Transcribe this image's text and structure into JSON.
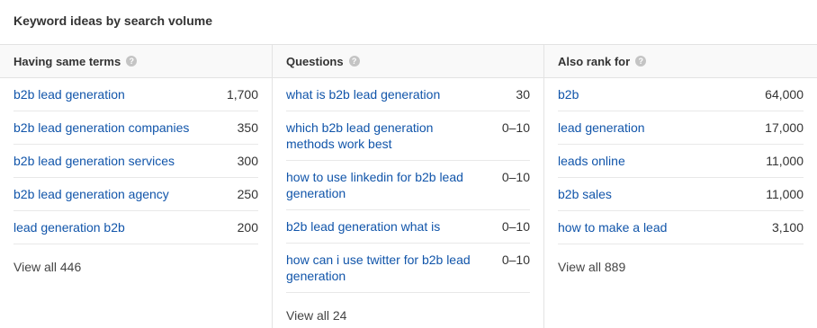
{
  "title": "Keyword ideas by search volume",
  "columns": [
    {
      "header": "Having same terms",
      "help_icon": "question-mark-circle",
      "rows": [
        {
          "keyword": "b2b lead generation",
          "volume": "1,700"
        },
        {
          "keyword": "b2b lead generation companies",
          "volume": "350"
        },
        {
          "keyword": "b2b lead generation services",
          "volume": "300"
        },
        {
          "keyword": "b2b lead generation agency",
          "volume": "250"
        },
        {
          "keyword": "lead generation b2b",
          "volume": "200"
        }
      ],
      "view_all": "View all 446"
    },
    {
      "header": "Questions",
      "help_icon": "question-mark-circle",
      "rows": [
        {
          "keyword": "what is b2b lead generation",
          "volume": "30"
        },
        {
          "keyword": "which b2b lead generation methods work best",
          "volume": "0–10"
        },
        {
          "keyword": "how to use linkedin for b2b lead generation",
          "volume": "0–10"
        },
        {
          "keyword": "b2b lead generation what is",
          "volume": "0–10"
        },
        {
          "keyword": "how can i use twitter for b2b lead generation",
          "volume": "0–10"
        }
      ],
      "view_all": "View all 24"
    },
    {
      "header": "Also rank for",
      "help_icon": "question-mark-circle",
      "rows": [
        {
          "keyword": "b2b",
          "volume": "64,000"
        },
        {
          "keyword": "lead generation",
          "volume": "17,000"
        },
        {
          "keyword": "leads online",
          "volume": "11,000"
        },
        {
          "keyword": "b2b sales",
          "volume": "11,000"
        },
        {
          "keyword": "how to make a lead",
          "volume": "3,100"
        }
      ],
      "view_all": "View all 889"
    }
  ],
  "colors": {
    "link": "#1155aa",
    "text": "#333333",
    "border": "#e3e3e3",
    "help_icon": "#c4c4c4"
  }
}
